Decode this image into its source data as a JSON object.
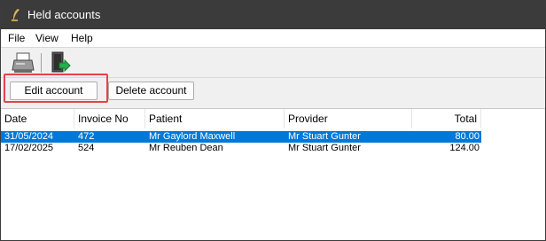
{
  "window": {
    "title": "Held accounts",
    "colors": {
      "titlebar": "#3b3b3b",
      "selection": "#0078d7",
      "highlight": "#e0454a"
    }
  },
  "menu": [
    {
      "label": "File"
    },
    {
      "label": "View"
    },
    {
      "label": "Help"
    }
  ],
  "toolbar": {
    "print_icon": "printer-icon",
    "exit_icon": "exit-door-icon"
  },
  "actions": {
    "edit_label": "Edit account",
    "delete_label": "Delete account"
  },
  "table": {
    "columns": [
      "Date",
      "Invoice No",
      "Patient",
      "Provider",
      "Total"
    ],
    "rows": [
      {
        "date": "31/05/2024",
        "invoice": "472",
        "patient": "Mr Gaylord Maxwell",
        "provider": "Mr Stuart Gunter",
        "total": "80.00",
        "selected": true
      },
      {
        "date": "17/02/2025",
        "invoice": "524",
        "patient": "Mr Reuben Dean",
        "provider": "Mr Stuart Gunter",
        "total": "124.00",
        "selected": false
      }
    ]
  }
}
